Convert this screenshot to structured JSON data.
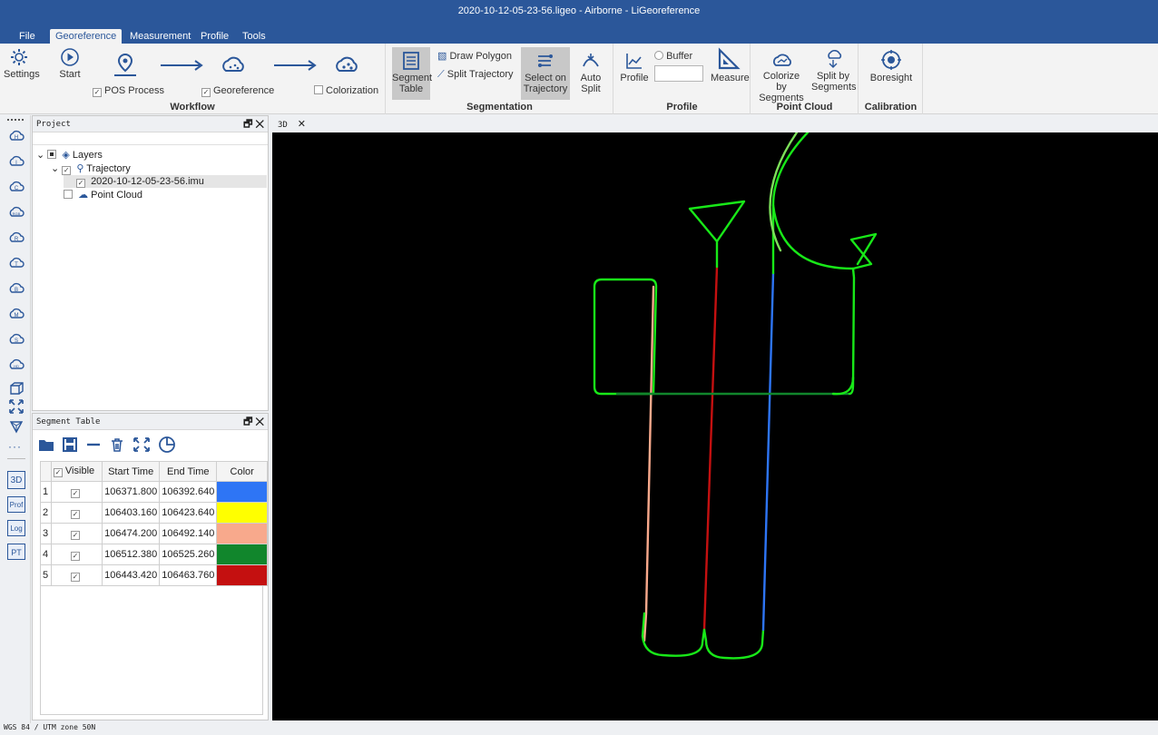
{
  "window": {
    "title": "2020-10-12-05-23-56.ligeo - Airborne - LiGeoreference"
  },
  "menu": [
    "File",
    "Georeference",
    "Measurement",
    "Profile",
    "Tools"
  ],
  "ribbon": {
    "workflow": {
      "label": "Workflow",
      "settings": "Settings",
      "start": "Start",
      "pos_process": "POS Process",
      "georeference": "Georeference",
      "colorization": "Colorization"
    },
    "segmentation": {
      "label": "Segmentation",
      "segment_table_1": "Segment",
      "segment_table_2": "Table",
      "draw_polygon": "Draw Polygon",
      "split_trajectory": "Split Trajectory",
      "select_1": "Select on",
      "select_2": "Trajectory",
      "auto_1": "Auto",
      "auto_2": "Split"
    },
    "profile": {
      "label": "Profile",
      "buffer": "Buffer",
      "profile": "Profile",
      "measure": "Measure"
    },
    "point_cloud": {
      "label": "Point Cloud",
      "colorize_1": "Colorize by",
      "colorize_2": "Segments",
      "split_1": "Split by",
      "split_2": "Segments"
    },
    "calibration": {
      "label": "Calibration",
      "boresight": "Boresight"
    }
  },
  "project_panel": {
    "title": "Project",
    "tree": {
      "layers": "Layers",
      "trajectory": "Trajectory",
      "imu_file": "2020-10-12-05-23-56.imu",
      "point_cloud": "Point Cloud"
    }
  },
  "segment_panel": {
    "title": "Segment Table",
    "columns": [
      "Visible",
      "Start Time",
      "End Time",
      "Color"
    ],
    "rows": [
      {
        "index": "1",
        "start": "106371.800",
        "end": "106392.640",
        "color": "#2e75f5"
      },
      {
        "index": "2",
        "start": "106403.160",
        "end": "106423.640",
        "color": "#ffff00"
      },
      {
        "index": "3",
        "start": "106474.200",
        "end": "106492.140",
        "color": "#f8a98c"
      },
      {
        "index": "4",
        "start": "106512.380",
        "end": "106525.260",
        "color": "#11862c"
      },
      {
        "index": "5",
        "start": "106443.420",
        "end": "106463.760",
        "color": "#c41010"
      }
    ]
  },
  "view_tab": "3D",
  "left_toolbar": {
    "labels": [
      "3D",
      "Prof",
      "Log",
      "PT"
    ]
  },
  "status": "WGS 84 / UTM zone 50N"
}
